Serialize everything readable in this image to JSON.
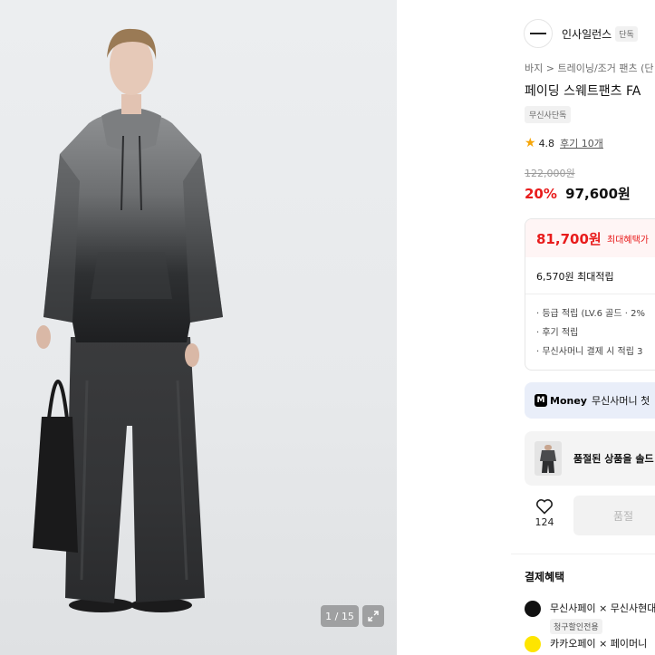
{
  "gallery": {
    "counter": "1 / 15"
  },
  "brand": {
    "name": "인사일런스",
    "badge": "단독"
  },
  "breadcrumb": {
    "level1": "바지",
    "separator": ">",
    "level2": "트레이닝/조거 팬츠 (단"
  },
  "product": {
    "title": "페이딩 스웨트팬츠 FA",
    "exclusive_badge": "무신사단독",
    "rating": "4.8",
    "reviews": "후기 10개",
    "original_price": "122,000원",
    "discount": "20%",
    "sale_price": "97,600원"
  },
  "benefits": {
    "max_price": "81,700원",
    "max_label": "최대혜택가",
    "points": "6,570원 최대적립",
    "items": [
      "· 등급 적립 (LV.6 골드 · 2%",
      "· 후기 적립",
      "· 무신사머니 결제 시 적립 3"
    ]
  },
  "money_banner": {
    "logo": "Money",
    "logo_mark": "M",
    "text": "무신사머니 첫"
  },
  "soldout": {
    "text": "품절된 상품을 솔드"
  },
  "actions": {
    "like_count": "124",
    "cart_label": "품절"
  },
  "payment": {
    "title": "결제혜택",
    "items": [
      {
        "label": "무신사페이 × 무신사현대",
        "tag": "청구할인전용",
        "icon_color": "#111111"
      },
      {
        "label": "카카오페이 × 페이머니",
        "icon_color": "#fee500"
      }
    ]
  },
  "colors": {
    "accent_red": "#e81c1c",
    "star": "#f6a609",
    "money_bg": "#e9eef9"
  }
}
